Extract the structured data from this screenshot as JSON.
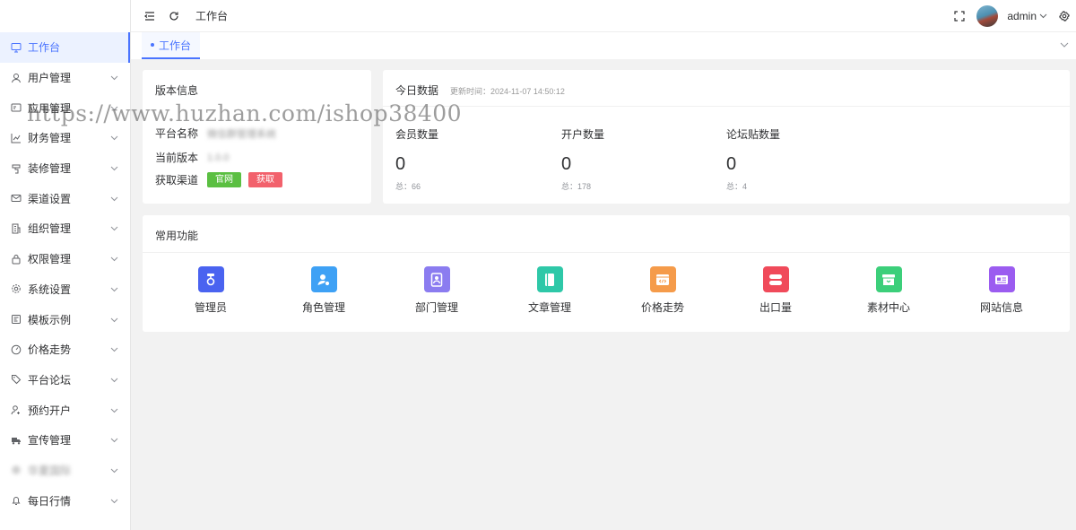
{
  "sidebar": {
    "items": [
      {
        "label": "工作台",
        "icon": "monitor-icon",
        "has_arrow": false,
        "active": true,
        "blurred": false
      },
      {
        "label": "用户管理",
        "icon": "user-icon",
        "has_arrow": true,
        "active": false,
        "blurred": false
      },
      {
        "label": "应用管理",
        "icon": "app-card-icon",
        "has_arrow": true,
        "active": false,
        "blurred": false
      },
      {
        "label": "财务管理",
        "icon": "chart-icon",
        "has_arrow": true,
        "active": false,
        "blurred": false
      },
      {
        "label": "装修管理",
        "icon": "decoration-icon",
        "has_arrow": true,
        "active": false,
        "blurred": false
      },
      {
        "label": "渠道设置",
        "icon": "mail-icon",
        "has_arrow": true,
        "active": false,
        "blurred": false
      },
      {
        "label": "组织管理",
        "icon": "building-icon",
        "has_arrow": true,
        "active": false,
        "blurred": false
      },
      {
        "label": "权限管理",
        "icon": "lock-icon",
        "has_arrow": true,
        "active": false,
        "blurred": false
      },
      {
        "label": "系统设置",
        "icon": "gear-icon",
        "has_arrow": true,
        "active": false,
        "blurred": false
      },
      {
        "label": "模板示例",
        "icon": "template-icon",
        "has_arrow": true,
        "active": false,
        "blurred": false
      },
      {
        "label": "价格走势",
        "icon": "gauge-icon",
        "has_arrow": true,
        "active": false,
        "blurred": false
      },
      {
        "label": "平台论坛",
        "icon": "tag-icon",
        "has_arrow": true,
        "active": false,
        "blurred": false
      },
      {
        "label": "预约开户",
        "icon": "user-plus-icon",
        "has_arrow": true,
        "active": false,
        "blurred": false
      },
      {
        "label": "宣传管理",
        "icon": "truck-icon",
        "has_arrow": true,
        "active": false,
        "blurred": false
      },
      {
        "label": "华夏国际",
        "icon": "circle-icon",
        "has_arrow": true,
        "active": false,
        "blurred": true
      },
      {
        "label": "每日行情",
        "icon": "bell-icon",
        "has_arrow": true,
        "active": false,
        "blurred": false
      }
    ]
  },
  "header": {
    "title": "工作台",
    "username": "admin"
  },
  "tabs": [
    {
      "label": "工作台",
      "active": true
    }
  ],
  "version_card": {
    "title": "版本信息",
    "platform_label": "平台名称",
    "platform_value": "微信群管理系统",
    "version_label": "当前版本",
    "version_value": "1.0.0",
    "channel_label": "获取渠道",
    "official_button": "官网",
    "get_button": "获取"
  },
  "today_card": {
    "title": "今日数据",
    "updated": "更新时间：2024-11-07 14:50:12",
    "stats": [
      {
        "label": "会员数量",
        "value": "0",
        "total": "总：66"
      },
      {
        "label": "开户数量",
        "value": "0",
        "total": "总：178"
      },
      {
        "label": "论坛贴数量",
        "value": "0",
        "total": "总：4"
      }
    ]
  },
  "functions": {
    "title": "常用功能",
    "items": [
      {
        "label": "管理员",
        "icon": "admin-icon",
        "color": "#4a63f0"
      },
      {
        "label": "角色管理",
        "icon": "role-icon",
        "color": "#3ea1f5"
      },
      {
        "label": "部门管理",
        "icon": "department-icon",
        "color": "#8b7cf0"
      },
      {
        "label": "文章管理",
        "icon": "article-icon",
        "color": "#2ec8a8"
      },
      {
        "label": "价格走势",
        "icon": "code-window-icon",
        "color": "#f59b4a"
      },
      {
        "label": "出口量",
        "icon": "server-icon",
        "color": "#f04a5a"
      },
      {
        "label": "素材中心",
        "icon": "box-icon",
        "color": "#3ccf7a"
      },
      {
        "label": "网站信息",
        "icon": "id-card-icon",
        "color": "#9b5cf0"
      }
    ]
  },
  "watermark": "https://www.huzhan.com/ishop38400"
}
